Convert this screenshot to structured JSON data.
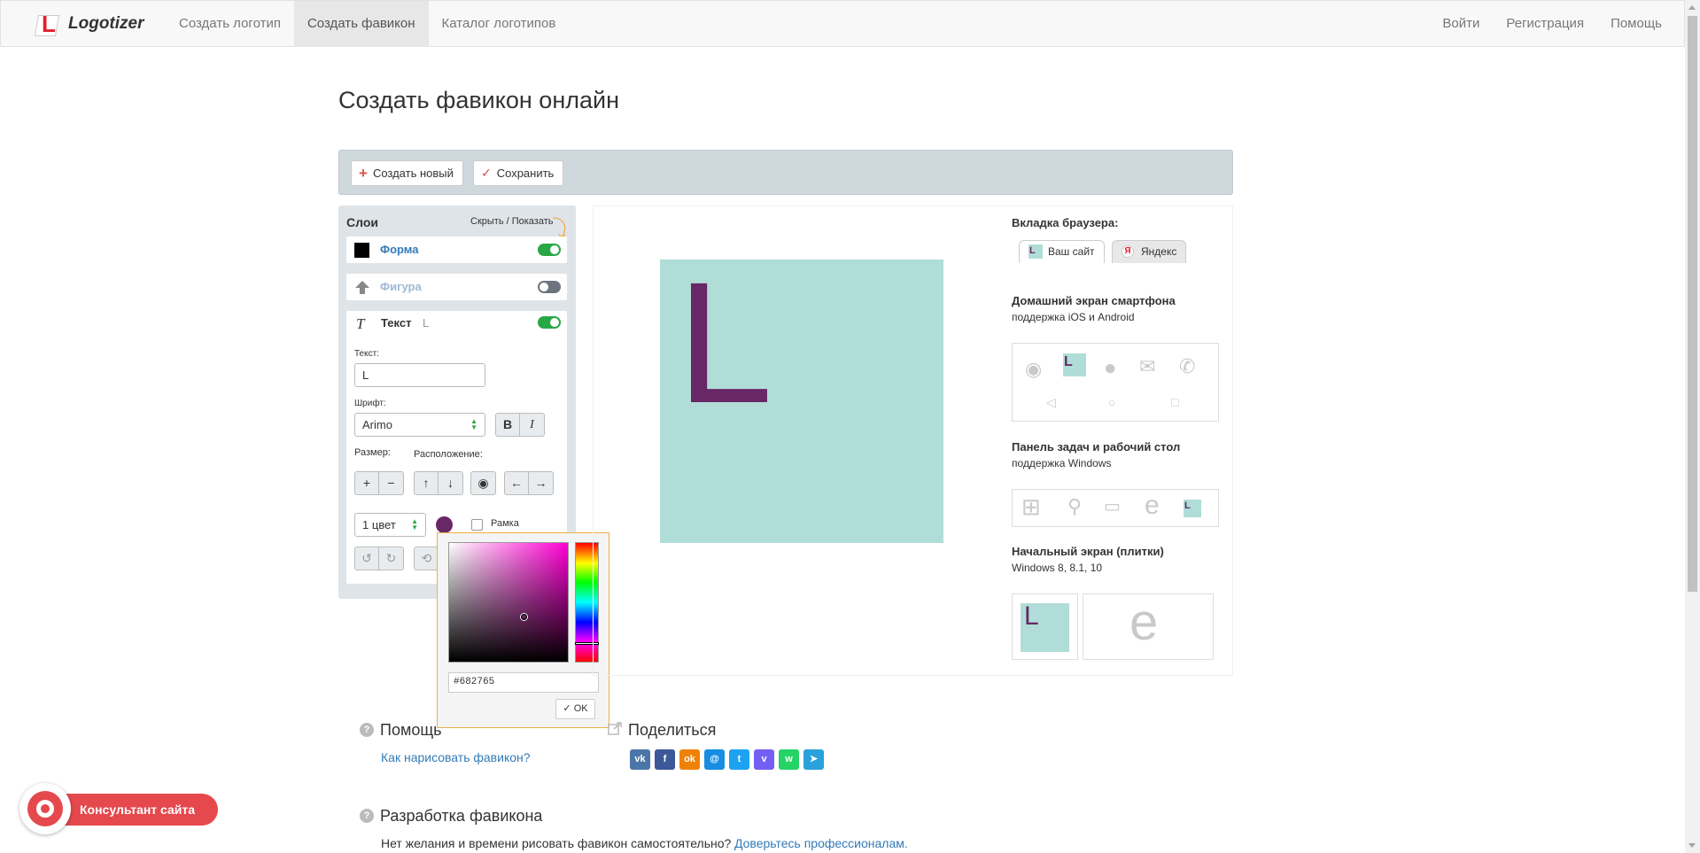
{
  "nav": {
    "logo_text": "Logotizer",
    "items": [
      "Создать логотип",
      "Создать фавикон",
      "Каталог логотипов"
    ],
    "right": [
      "Войти",
      "Регистрация",
      "Помощь"
    ]
  },
  "page_title": "Создать фавикон онлайн",
  "toolbar": {
    "create_label": "Создать новый",
    "save_label": "Сохранить"
  },
  "layers": {
    "title": "Слои",
    "hide_show": "Скрыть / Показать",
    "items": [
      {
        "name": "Форма",
        "color": "#000000",
        "enabled": true
      },
      {
        "name": "Фигура",
        "enabled": false
      },
      {
        "name": "Текст",
        "value": "L",
        "enabled": true
      }
    ],
    "text_label": "Текст:",
    "text_value": "L",
    "font_label": "Шрифт:",
    "font_value": "Arimo",
    "bold": "B",
    "italic": "I",
    "size_label": "Размер:",
    "position_label": "Расположение:",
    "colors_value": "1 цвет",
    "frame_label": "Рамка",
    "text_color": "#682765"
  },
  "picker": {
    "hex": "#682765",
    "ok_label": "OK"
  },
  "preview": {
    "letter": "L",
    "bg_color": "#b0ddd8",
    "letter_color": "#682765"
  },
  "side": {
    "browser_tab_heading": "Вкладка браузера:",
    "tab_yours": "Ваш сайт",
    "tab_yandex": "Яндекс",
    "yandex_glyph": "Я",
    "phone_heading": "Домашний экран смартфона",
    "phone_sub": "поддержка iOS и Android",
    "taskbar_heading": "Панель задач и рабочий стол",
    "taskbar_sub": "поддержка Windows",
    "tiles_heading": "Начальный экран (плитки)",
    "tiles_sub": "Windows 8, 8.1, 10",
    "mini_letter": "L",
    "edge_glyph": "e"
  },
  "help": {
    "help_heading": "Помощь",
    "help_link": "Как нарисовать фавикон?",
    "share_heading": "Поделиться",
    "dev_heading": "Разработка фавикона",
    "dev_text": "Нет желания и времени рисовать фавикон самостоятельно?",
    "dev_link": "Доверьтесь профессионалам.",
    "q_glyph": "?"
  },
  "social": [
    {
      "name": "vk",
      "glyph": "vk",
      "color": "#4a76a8"
    },
    {
      "name": "facebook",
      "glyph": "f",
      "color": "#3b5998"
    },
    {
      "name": "odnoklassniki",
      "glyph": "ok",
      "color": "#ee8208"
    },
    {
      "name": "mail-ru",
      "glyph": "@",
      "color": "#168de2"
    },
    {
      "name": "twitter",
      "glyph": "t",
      "color": "#1da1f2"
    },
    {
      "name": "viber",
      "glyph": "v",
      "color": "#7360f2"
    },
    {
      "name": "whatsapp",
      "glyph": "w",
      "color": "#25d366"
    },
    {
      "name": "telegram",
      "glyph": "➤",
      "color": "#2aa1da"
    }
  ],
  "consultant": {
    "label": "Консультант сайта"
  }
}
